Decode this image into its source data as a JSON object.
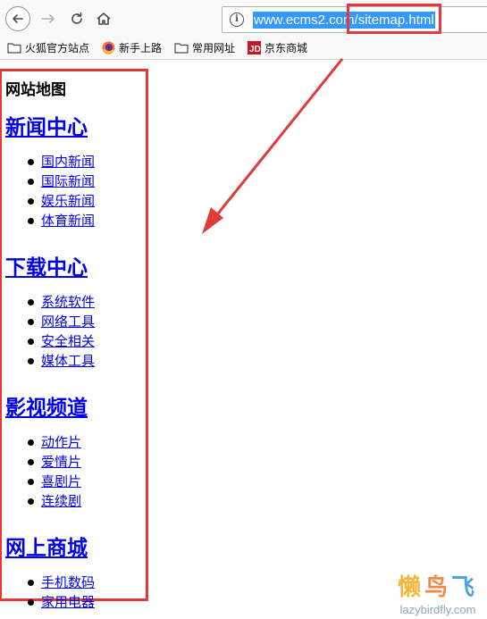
{
  "browser": {
    "url": "www.ecms2.com/sitemap.html",
    "bookmarks": [
      {
        "label": "火狐官方站点",
        "icon": "folder-icon"
      },
      {
        "label": "新手上路",
        "icon": "firefox-icon"
      },
      {
        "label": "常用网址",
        "icon": "folder-icon"
      },
      {
        "label": "京东商城",
        "icon": "jd-icon"
      }
    ]
  },
  "page": {
    "title": "网站地图",
    "sections": [
      {
        "heading": "新闻中心",
        "links": [
          "国内新闻",
          "国际新闻",
          "娱乐新闻",
          "体育新闻"
        ]
      },
      {
        "heading": "下载中心",
        "links": [
          "系统软件",
          "网络工具",
          "安全相关",
          "媒体工具"
        ]
      },
      {
        "heading": "影视频道",
        "links": [
          "动作片",
          "爱情片",
          "喜剧片",
          "连续剧"
        ]
      },
      {
        "heading": "网上商城",
        "links": [
          "手机数码",
          "家用电器"
        ]
      }
    ]
  },
  "watermark": {
    "logo": [
      "懒",
      "鸟",
      "飞"
    ],
    "url": "lazybirdfly.com"
  },
  "colors": {
    "annotation": "#e03a3a",
    "link": "#0000ee",
    "selection": "#3399ff"
  }
}
